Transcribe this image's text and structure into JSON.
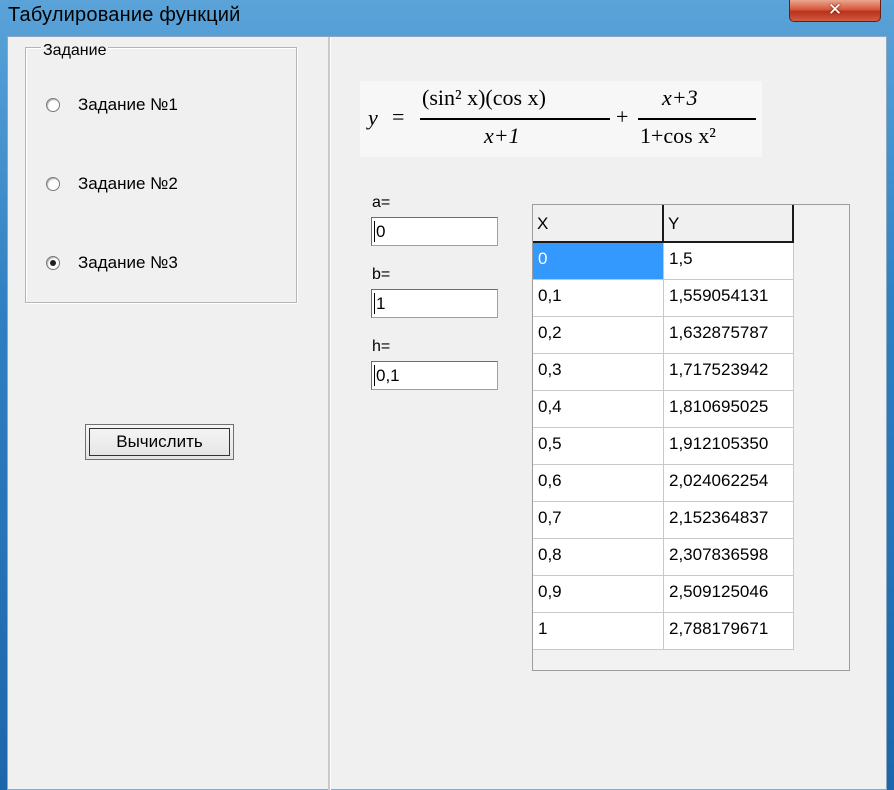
{
  "window": {
    "title": "Табулирование функций",
    "close_glyph": "✕"
  },
  "group": {
    "title": "Задание",
    "options": [
      {
        "label": "Задание №1",
        "checked": false
      },
      {
        "label": "Задание №2",
        "checked": false
      },
      {
        "label": "Задание №3",
        "checked": true
      }
    ]
  },
  "calc_button": {
    "label": "Вычислить"
  },
  "formula": {
    "y": "y",
    "eq": "=",
    "num1": "(sin² x)(cos x)",
    "den1": "x+1",
    "plus": "+",
    "num2": "x+3",
    "den2": "1+cos x²"
  },
  "inputs": {
    "a": {
      "label": "a=",
      "value": "0"
    },
    "b": {
      "label": "b=",
      "value": "1"
    },
    "h": {
      "label": "h=",
      "value": "0,1"
    }
  },
  "table": {
    "headers": [
      "X",
      "Y"
    ],
    "rows": [
      [
        "0",
        "1,5"
      ],
      [
        "0,1",
        "1,559054131"
      ],
      [
        "0,2",
        "1,632875787"
      ],
      [
        "0,3",
        "1,717523942"
      ],
      [
        "0,4",
        "1,810695025"
      ],
      [
        "0,5",
        "1,912105350"
      ],
      [
        "0,6",
        "2,024062254"
      ],
      [
        "0,7",
        "2,152364837"
      ],
      [
        "0,8",
        "2,307836598"
      ],
      [
        "0,9",
        "2,509125046"
      ],
      [
        "1",
        "2,788179671"
      ]
    ],
    "selected_cell": "0"
  },
  "colors": {
    "titlebar": "#2f7fc1",
    "close": "#d8573b",
    "selection": "#3399ff",
    "window_bg": "#f0f0f0"
  }
}
